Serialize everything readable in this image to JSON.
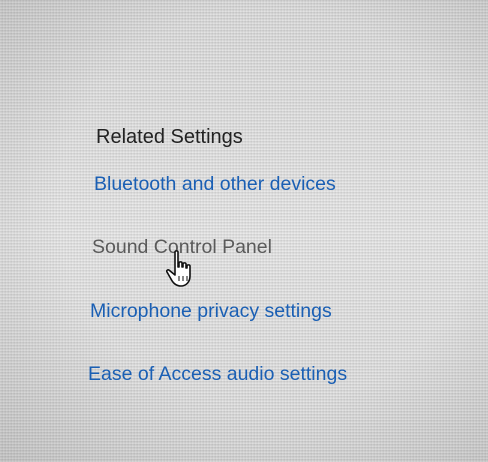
{
  "related_settings": {
    "title": "Related Settings",
    "links": [
      "Bluetooth and other devices",
      "Sound Control Panel",
      "Microphone privacy settings",
      "Ease of Access audio settings"
    ],
    "hovered_link_index": 1
  },
  "colors": {
    "link": "#1a5fb4",
    "hovered_link": "#5a5a5a",
    "title": "#222222"
  },
  "cursor": {
    "icon": "hand-pointer-icon"
  }
}
